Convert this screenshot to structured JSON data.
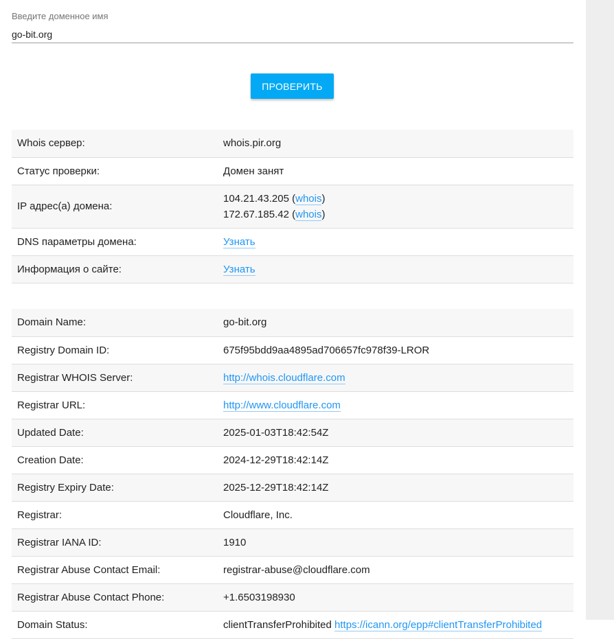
{
  "search": {
    "label": "Введите доменное имя",
    "value": "go-bit.org"
  },
  "check_button": "ПРОВЕРИТЬ",
  "summary": {
    "whois_server_label": "Whois сервер:",
    "whois_server_value": "whois.pir.org",
    "status_label": "Статус проверки:",
    "status_value": "Домен занят",
    "ip_label": "IP адрес(а) домена:",
    "ips": [
      {
        "ip": "104.21.43.205",
        "link": "whois"
      },
      {
        "ip": "172.67.185.42",
        "link": "whois"
      }
    ],
    "dns_label": "DNS параметры домена:",
    "dns_link": "Узнать",
    "site_label": "Информация о сайте:",
    "site_link": "Узнать"
  },
  "whois": [
    {
      "key": "Domain Name:",
      "value": "go-bit.org"
    },
    {
      "key": "Registry Domain ID:",
      "value": "675f95bdd9aa4895ad706657fc978f39-LROR"
    },
    {
      "key": "Registrar WHOIS Server:",
      "value": "http://whois.cloudflare.com"
    },
    {
      "key": "Registrar URL:",
      "value": "http://www.cloudflare.com"
    },
    {
      "key": "Updated Date:",
      "value": "2025-01-03T18:42:54Z"
    },
    {
      "key": "Creation Date:",
      "value": "2024-12-29T18:42:14Z"
    },
    {
      "key": "Registry Expiry Date:",
      "value": "2025-12-29T18:42:14Z"
    },
    {
      "key": "Registrar:",
      "value": "Cloudflare, Inc."
    },
    {
      "key": "Registrar IANA ID:",
      "value": "1910"
    },
    {
      "key": "Registrar Abuse Contact Email:",
      "value": "registrar-abuse@cloudflare.com"
    },
    {
      "key": "Registrar Abuse Contact Phone:",
      "value": "+1.6503198930"
    },
    {
      "key": "Domain Status:",
      "value": "clientTransferProhibited",
      "link": "https://icann.org/epp#clientTransferProhibited"
    }
  ],
  "colors": {
    "accent": "#03a9f4",
    "link": "#2196f3"
  }
}
